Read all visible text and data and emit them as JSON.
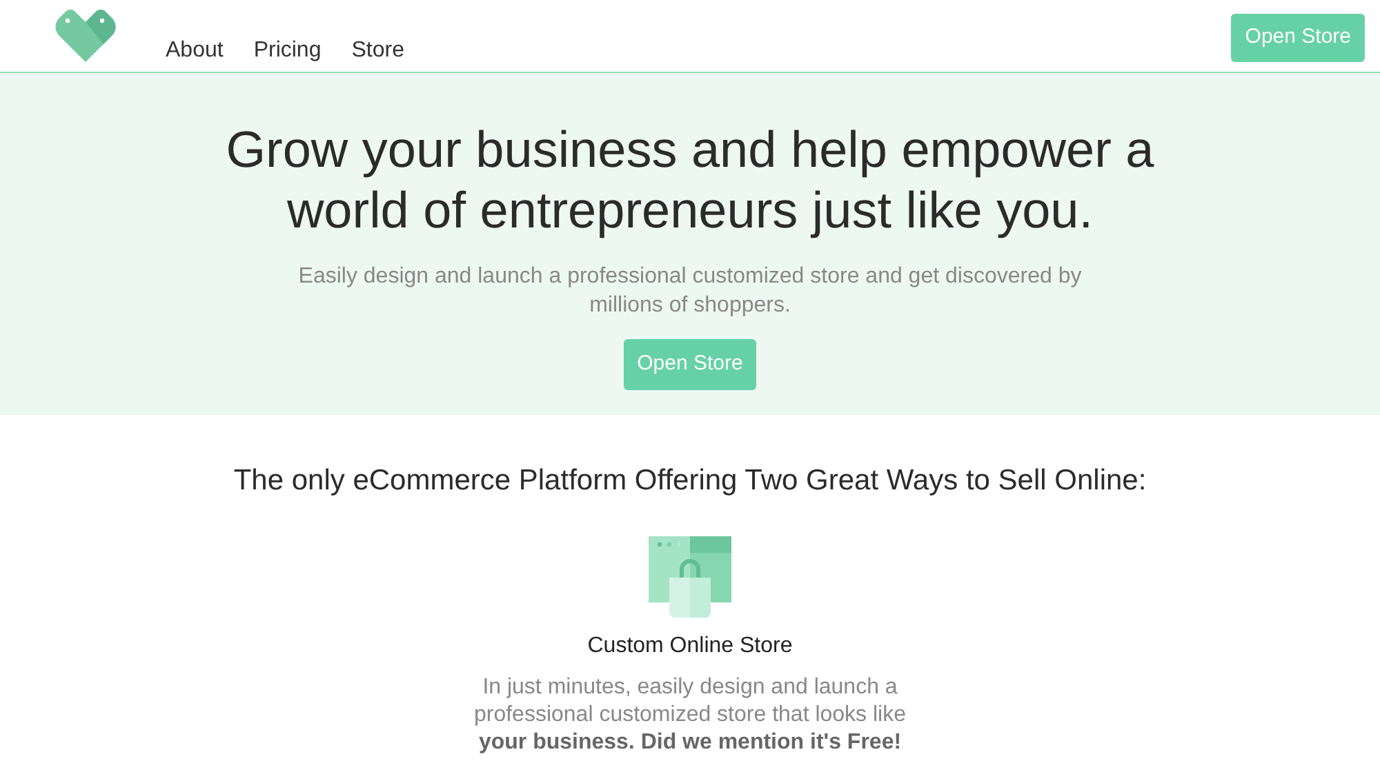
{
  "nav": {
    "links": [
      "About",
      "Pricing",
      "Store"
    ],
    "button": "Open Store"
  },
  "hero": {
    "title": "Grow your business and help empower a world of entrepreneurs just like you.",
    "subtitle": "Easily design and launch a professional customized store and get discovered by millions of shoppers.",
    "button": "Open Store"
  },
  "features": {
    "heading": "The only eCommerce Platform Offering Two Great Ways to Sell Online:",
    "items": [
      {
        "title": "Custom Online Store",
        "text": "In just minutes, easily design and launch a professional customized store that looks like **your business. Did we mention it's Free!**"
      }
    ]
  }
}
